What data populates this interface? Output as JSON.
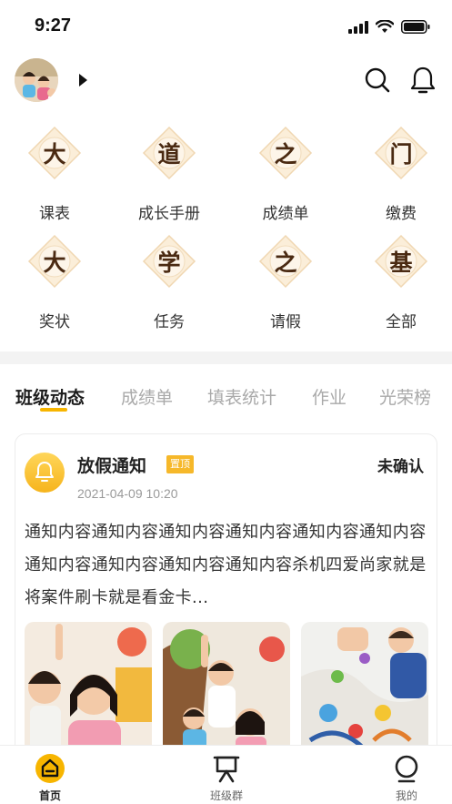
{
  "status_bar": {
    "time": "9:27"
  },
  "header": {
    "avatar_icon": "children-photo",
    "dropdown_icon": "caret-right-icon",
    "search_icon": "search-icon",
    "bell_icon": "bell-icon"
  },
  "grid": [
    {
      "char": "大",
      "label": "课表"
    },
    {
      "char": "道",
      "label": "成长手册"
    },
    {
      "char": "之",
      "label": "成绩单"
    },
    {
      "char": "门",
      "label": "缴费"
    },
    {
      "char": "大",
      "label": "奖状"
    },
    {
      "char": "学",
      "label": "任务"
    },
    {
      "char": "之",
      "label": "请假"
    },
    {
      "char": "基",
      "label": "全部"
    }
  ],
  "tabs": [
    "班级动态",
    "成绩单",
    "填表统计",
    "作业",
    "光荣榜"
  ],
  "active_tab": 0,
  "notice": {
    "title": "放假通知",
    "badge": "置顶",
    "status": "未确认",
    "time": "2021-04-09 10:20",
    "body": "通知内容通知内容通知内容通知内容通知内容通知内容通知内容通知内容通知内容通知内容杀机四爱尚家就是将案件刷卡就是看金卡..."
  },
  "bottom_nav": [
    {
      "label": "首页",
      "icon": "home-icon",
      "active": true
    },
    {
      "label": "班级群",
      "icon": "presentation-board-icon",
      "active": false
    },
    {
      "label": "我的",
      "icon": "profile-icon",
      "active": false
    }
  ],
  "colors": {
    "accent": "#f7b500",
    "medal_fill": "#fbeed9",
    "text_dark": "#222222",
    "text_muted": "#a9a9a9"
  }
}
